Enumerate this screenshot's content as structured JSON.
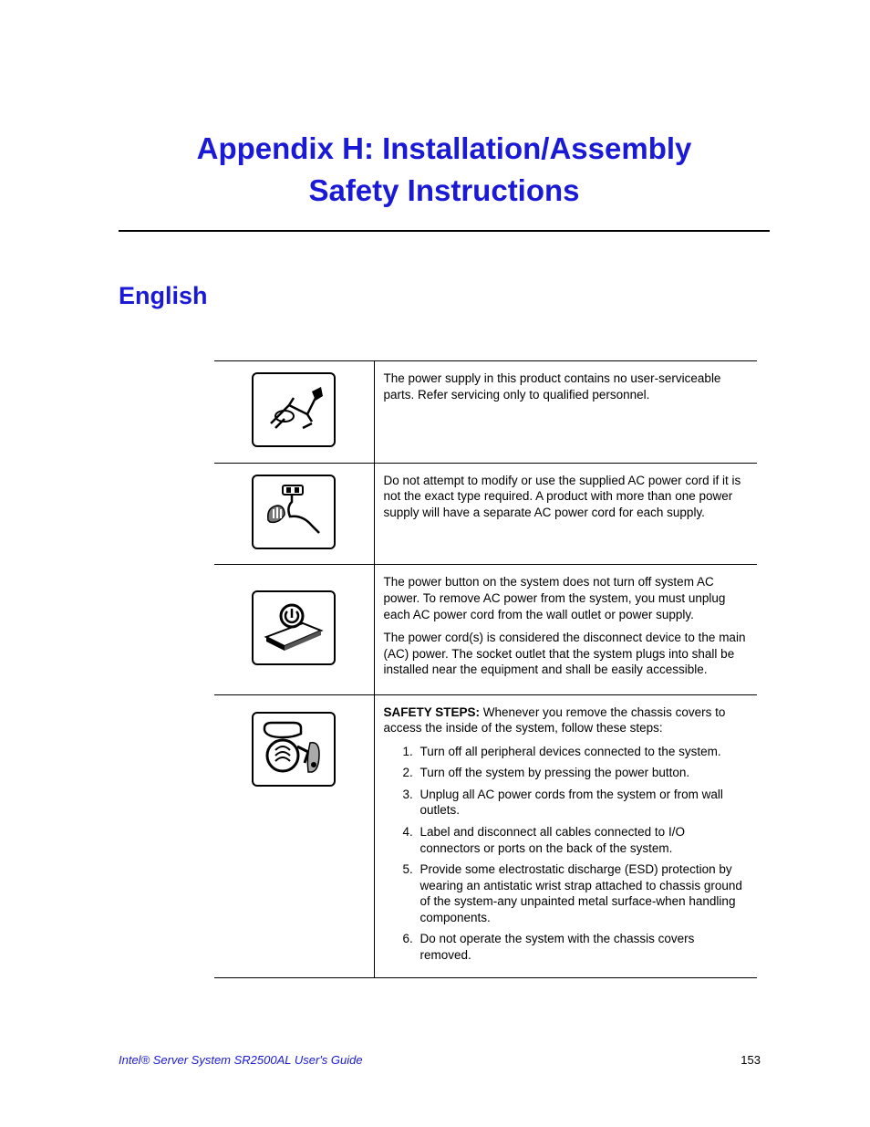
{
  "title_line1": "Appendix H:  Installation/Assembly",
  "title_line2": "Safety Instructions",
  "section": "English",
  "rows": [
    {
      "icon": "servicing-icon",
      "text": "The power supply in this product contains no user-serviceable parts. Refer servicing only to qualified personnel."
    },
    {
      "icon": "no-cord-modify-icon",
      "text": "Do not attempt to modify or use the supplied AC power cord if it is not the exact type required. A product with more than one power supply will have a separate AC power cord for each supply."
    },
    {
      "icon": "power-button-icon",
      "para1": "The power button on the system does not turn off system AC power. To remove AC power from the system, you must unplug each AC power cord from the wall outlet or power supply.",
      "para2": "The power cord(s) is considered the disconnect device to the main (AC) power. The socket outlet that the system plugs into shall be installed near the equipment and shall be easily accessible."
    },
    {
      "icon": "safety-steps-icon",
      "label": "SAFETY STEPS:",
      "intro": " Whenever you remove the chassis covers to access the inside of the system, follow these steps:",
      "steps": [
        "Turn off all peripheral devices connected to the system.",
        "Turn off the system by pressing the power button.",
        "Unplug all AC power cords from the system or from wall outlets.",
        "Label and disconnect all cables connected to I/O connectors or ports on the back of the system.",
        "Provide some electrostatic discharge (ESD) protection by wearing an antistatic wrist strap attached to chassis ground of the system-any unpainted metal surface-when handling components.",
        "Do not operate the system with the chassis covers removed."
      ]
    }
  ],
  "footer_left": "Intel® Server System SR2500AL User's Guide",
  "footer_right": "153"
}
